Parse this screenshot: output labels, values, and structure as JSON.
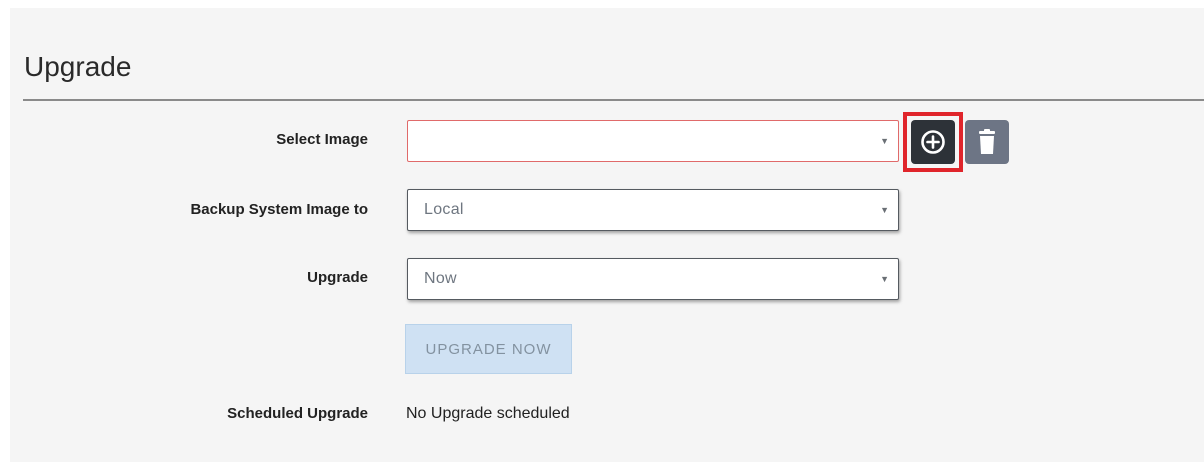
{
  "page": {
    "title": "Upgrade"
  },
  "form": {
    "select_image": {
      "label": "Select Image",
      "value": "",
      "state": "invalid"
    },
    "backup_system_image": {
      "label": "Backup System Image to",
      "value": "Local"
    },
    "upgrade": {
      "label": "Upgrade",
      "value": "Now"
    },
    "upgrade_now_button": "UPGRADE NOW",
    "scheduled_upgrade": {
      "label": "Scheduled Upgrade",
      "value": "No Upgrade scheduled"
    }
  },
  "icons": {
    "add": "plus-circle-icon",
    "delete": "trash-icon",
    "dropdown": "caret-down-icon"
  },
  "colors": {
    "highlight_box": "#e0252b",
    "invalid_border": "#e06a6a",
    "add_button": "#2d3238",
    "delete_button": "#6d7585",
    "disabled_button": "#cfe1f3"
  }
}
